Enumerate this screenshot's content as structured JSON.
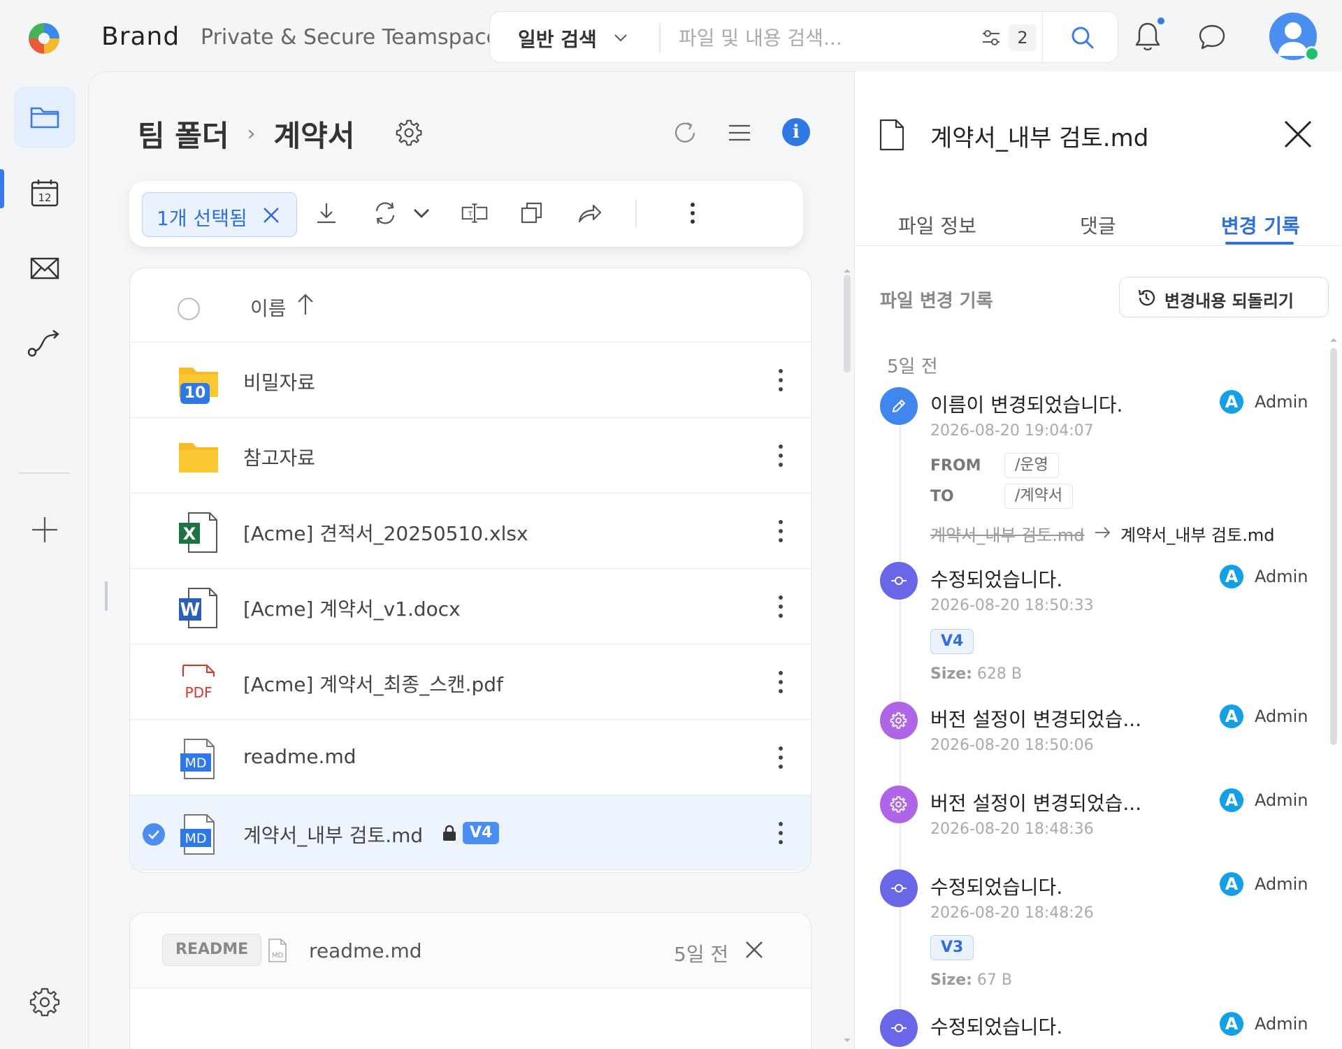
{
  "header": {
    "brand": "Brand",
    "teamspace": "Private & Secure Teamspace",
    "search_mode": "일반 검색",
    "search_placeholder": "파일 및 내용 검색...",
    "filter_count": "2"
  },
  "breadcrumb": {
    "root": "팀 폴더",
    "separator": "›",
    "current": "계약서"
  },
  "toolbar": {
    "selected_label": "1개 선택됨"
  },
  "list": {
    "header_name": "이름",
    "rows": [
      {
        "name": "비밀자료",
        "type": "folder",
        "badge": "10"
      },
      {
        "name": "참고자료",
        "type": "folder"
      },
      {
        "name": "[Acme] 견적서_20250510.xlsx",
        "type": "excel"
      },
      {
        "name": "[Acme] 계약서_v1.docx",
        "type": "word"
      },
      {
        "name": "[Acme] 계약서_최종_스캔.pdf",
        "type": "pdf"
      },
      {
        "name": "readme.md",
        "type": "md"
      },
      {
        "name": "계약서_내부 검토.md",
        "type": "md",
        "selected": true,
        "locked": true,
        "version": "V4"
      }
    ]
  },
  "file_type_labels": {
    "excel": "X",
    "word": "W",
    "pdf": "PDF",
    "md": "MD"
  },
  "readme": {
    "tag": "README",
    "name": "readme.md",
    "time": "5일 전"
  },
  "panel": {
    "title": "계약서_내부 검토.md",
    "tabs": [
      "파일 정보",
      "댓글",
      "변경 기록"
    ],
    "active_tab": 2,
    "history_heading": "파일 변경 기록",
    "revert_label": "변경내용 되돌리기",
    "day_label": "5일 전",
    "events": [
      {
        "kind": "rename",
        "title": "이름이 변경되었습니다.",
        "time": "2026-08-20 19:04:07",
        "user": "Admin",
        "user_initial": "A",
        "from_label": "FROM",
        "from": "/운영",
        "to_label": "TO",
        "to": "/계약서",
        "old_name": "계약서_내부 검토.md",
        "new_name": "계약서_내부 검토.md"
      },
      {
        "kind": "edit",
        "title": "수정되었습니다.",
        "time": "2026-08-20 18:50:33",
        "user": "Admin",
        "user_initial": "A",
        "version": "V4",
        "size_label": "Size:",
        "size": "628 B"
      },
      {
        "kind": "setting",
        "title": "버전 설정이 변경되었습...",
        "time": "2026-08-20 18:50:06",
        "user": "Admin",
        "user_initial": "A"
      },
      {
        "kind": "setting",
        "title": "버전 설정이 변경되었습...",
        "time": "2026-08-20 18:48:36",
        "user": "Admin",
        "user_initial": "A"
      },
      {
        "kind": "edit",
        "title": "수정되었습니다.",
        "time": "2026-08-20 18:48:26",
        "user": "Admin",
        "user_initial": "A",
        "version": "V3",
        "size_label": "Size:",
        "size": "67 B"
      },
      {
        "kind": "edit",
        "title": "수정되었습니다.",
        "user": "Admin",
        "user_initial": "A"
      }
    ]
  },
  "colors": {
    "accent": "#2f78e8",
    "edit_dot": "#6a66e8",
    "setting_dot": "#b064e8",
    "rename_dot": "#3f86ee",
    "user_avatar": "#12a0e6",
    "folder": "#f7bb2a",
    "excel": "#1f7244",
    "word": "#2b5fb8",
    "pdf": "#d8342c"
  }
}
